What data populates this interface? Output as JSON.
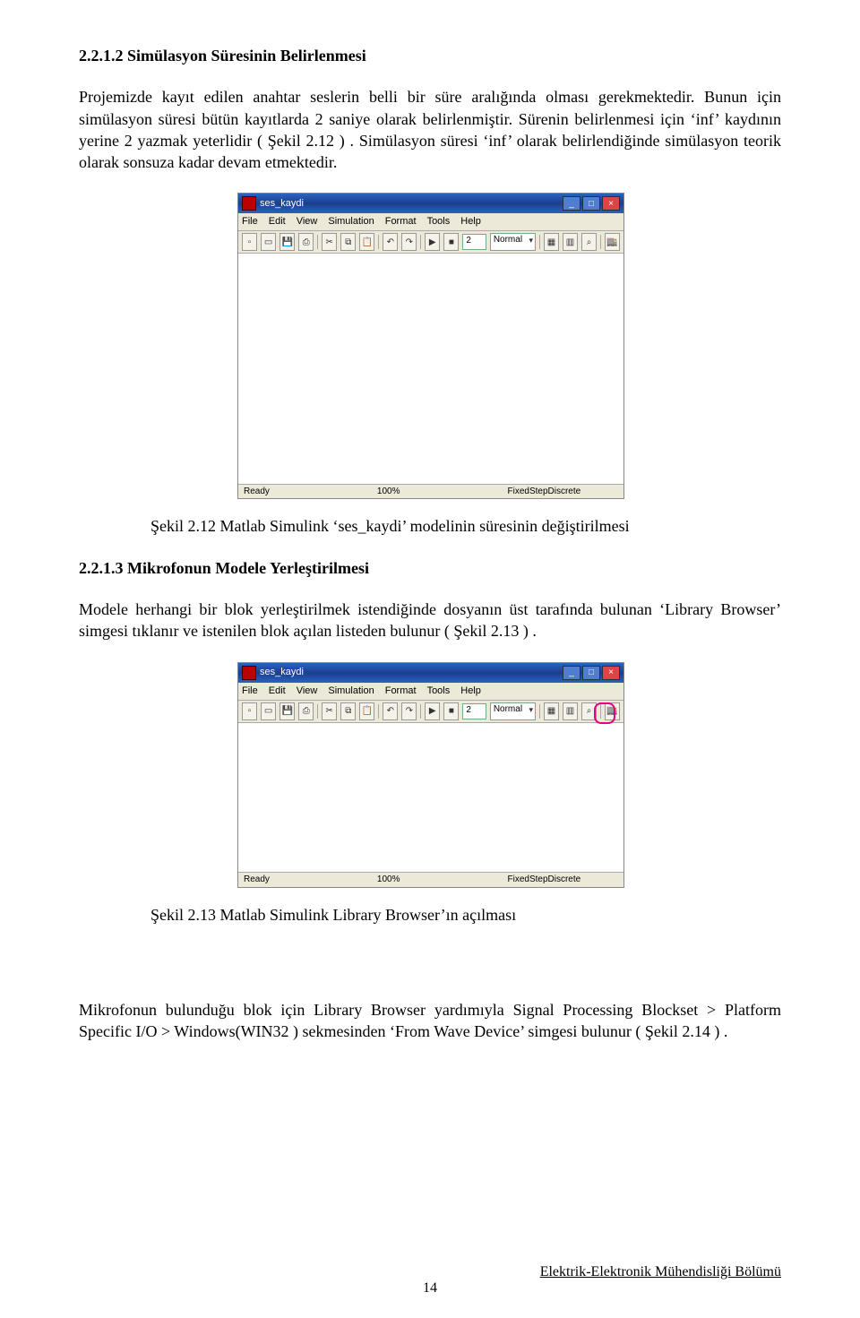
{
  "section1": {
    "num": "2.2.1.2 Simülasyon Süresinin Belirlenmesi",
    "p1": "Projemizde kayıt edilen anahtar seslerin belli bir süre aralığında olması gerekmektedir. Bunun için simülasyon süresi bütün kayıtlarda 2 saniye olarak belirlenmiştir. Sürenin belirlenmesi için ‘inf’ kaydının yerine 2 yazmak yeterlidir ( Şekil 2.12 ) . Simülasyon süresi ‘inf’ olarak belirlendiğinde simülasyon teorik olarak sonsuza kadar devam etmektedir."
  },
  "fig1": {
    "title": "ses_kaydi",
    "menu": [
      "File",
      "Edit",
      "View",
      "Simulation",
      "Format",
      "Tools",
      "Help"
    ],
    "sim_value": "2",
    "mode": "Normal",
    "status_left": "Ready",
    "status_mid": "100%",
    "status_right": "FixedStepDiscrete",
    "caption": "Şekil 2.12  Matlab Simulink ‘ses_kaydi’ modelinin süresinin değiştirilmesi"
  },
  "section2": {
    "num": "2.2.1.3 Mikrofonun Modele Yerleştirilmesi",
    "p1": "Modele herhangi bir blok yerleştirilmek istendiğinde dosyanın üst tarafında bulunan ‘Library Browser’ simgesi tıklanır ve istenilen blok açılan listeden bulunur ( Şekil 2.13 ) ."
  },
  "fig2": {
    "title": "ses_kaydi",
    "menu": [
      "File",
      "Edit",
      "View",
      "Simulation",
      "Format",
      "Tools",
      "Help"
    ],
    "sim_value": "2",
    "mode": "Normal",
    "status_left": "Ready",
    "status_mid": "100%",
    "status_right": "FixedStepDiscrete",
    "caption": "Şekil 2.13  Matlab Simulink Library Browser’ın açılması"
  },
  "para_bottom": "Mikrofonun bulunduğu blok için Library Browser yardımıyla Signal Processing Blockset > Platform Specific I/O > Windows(WIN32 ) sekmesinden ‘From Wave Device’ simgesi bulunur ( Şekil 2.14 ) .",
  "footer": "Elektrik-Elektronik Mühendisliği Bölümü",
  "pagenum": "14"
}
